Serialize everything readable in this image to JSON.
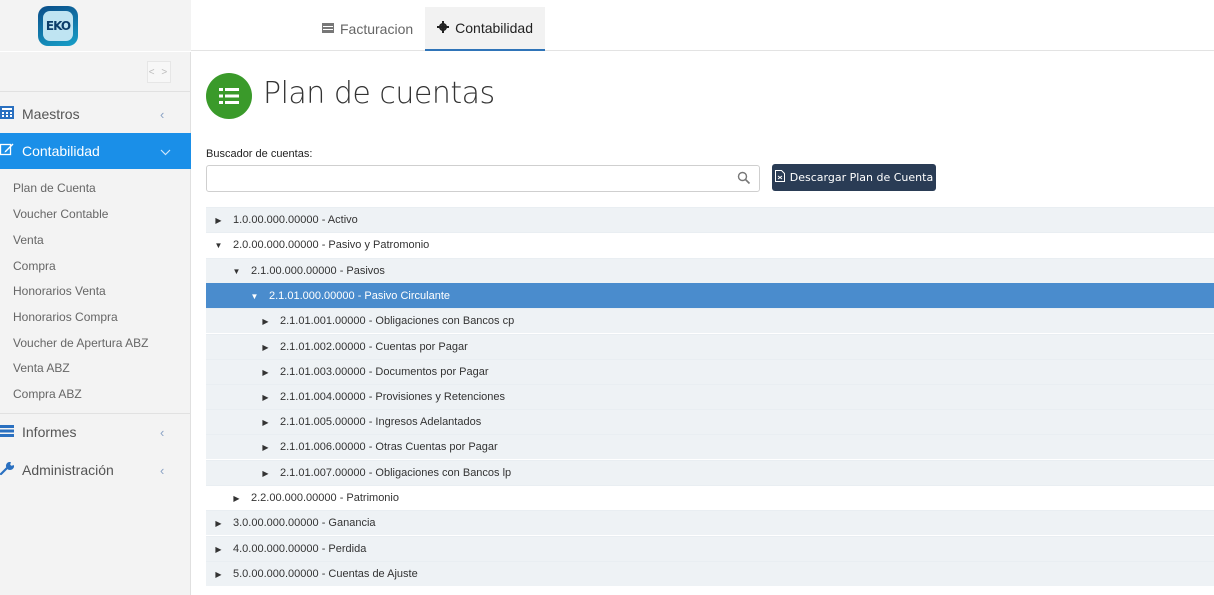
{
  "app": {
    "logo_text": "EKO"
  },
  "tabs": [
    {
      "label": "Facturacion",
      "icon": "table-icon"
    },
    {
      "label": "Contabilidad",
      "icon": "gear-icon",
      "active": true
    }
  ],
  "sidebar": {
    "collapse_label": "< >",
    "items": [
      {
        "label": "Maestros",
        "icon": "calculator-icon"
      },
      {
        "label": "Contabilidad",
        "icon": "edit-icon",
        "active": true
      },
      {
        "label": "Informes",
        "icon": "list-icon"
      },
      {
        "label": "Administración",
        "icon": "wrench-icon"
      }
    ],
    "subitems": [
      "Plan de Cuenta",
      "Voucher Contable",
      "Venta",
      "Compra",
      "Honorarios Venta",
      "Honorarios Compra",
      "Voucher de Apertura ABZ",
      "Venta ABZ",
      "Compra ABZ"
    ]
  },
  "main": {
    "title": "Plan de cuentas",
    "search_label": "Buscador de cuentas:",
    "search_value": "",
    "download_label": "Descargar Plan de Cuenta"
  },
  "tree": [
    {
      "text": "1.0.00.000.00000 - Activo",
      "level": 0,
      "expanded": false
    },
    {
      "text": "2.0.00.000.00000 - Pasivo y Patromonio",
      "level": 0,
      "expanded": true
    },
    {
      "text": "2.1.00.000.00000 - Pasivos",
      "level": 1,
      "expanded": true
    },
    {
      "text": "2.1.01.000.00000 - Pasivo Circulante",
      "level": 2,
      "expanded": true,
      "selected": true
    },
    {
      "text": "2.1.01.001.00000 - Obligaciones con Bancos cp",
      "level": 3,
      "expanded": false
    },
    {
      "text": "2.1.01.002.00000 - Cuentas por Pagar",
      "level": 3,
      "expanded": false
    },
    {
      "text": "2.1.01.003.00000 - Documentos por Pagar",
      "level": 3,
      "expanded": false
    },
    {
      "text": "2.1.01.004.00000 - Provisiones y Retenciones",
      "level": 3,
      "expanded": false
    },
    {
      "text": "2.1.01.005.00000 - Ingresos Adelantados",
      "level": 3,
      "expanded": false
    },
    {
      "text": "2.1.01.006.00000 - Otras Cuentas por Pagar",
      "level": 3,
      "expanded": false
    },
    {
      "text": "2.1.01.007.00000 - Obligaciones con Bancos lp",
      "level": 3,
      "expanded": false
    },
    {
      "text": "2.2.00.000.00000 - Patrimonio",
      "level": 1,
      "expanded": false
    },
    {
      "text": "3.0.00.000.00000 - Ganancia",
      "level": 0,
      "expanded": false
    },
    {
      "text": "4.0.00.000.00000 - Perdida",
      "level": 0,
      "expanded": false
    },
    {
      "text": "5.0.00.000.00000 - Cuentas de Ajuste",
      "level": 0,
      "expanded": false
    }
  ],
  "colors": {
    "accent": "#1a8fe8",
    "selected_row": "#4a8ccd",
    "title_icon": "#3a9a2a",
    "button": "#2a3c55"
  }
}
